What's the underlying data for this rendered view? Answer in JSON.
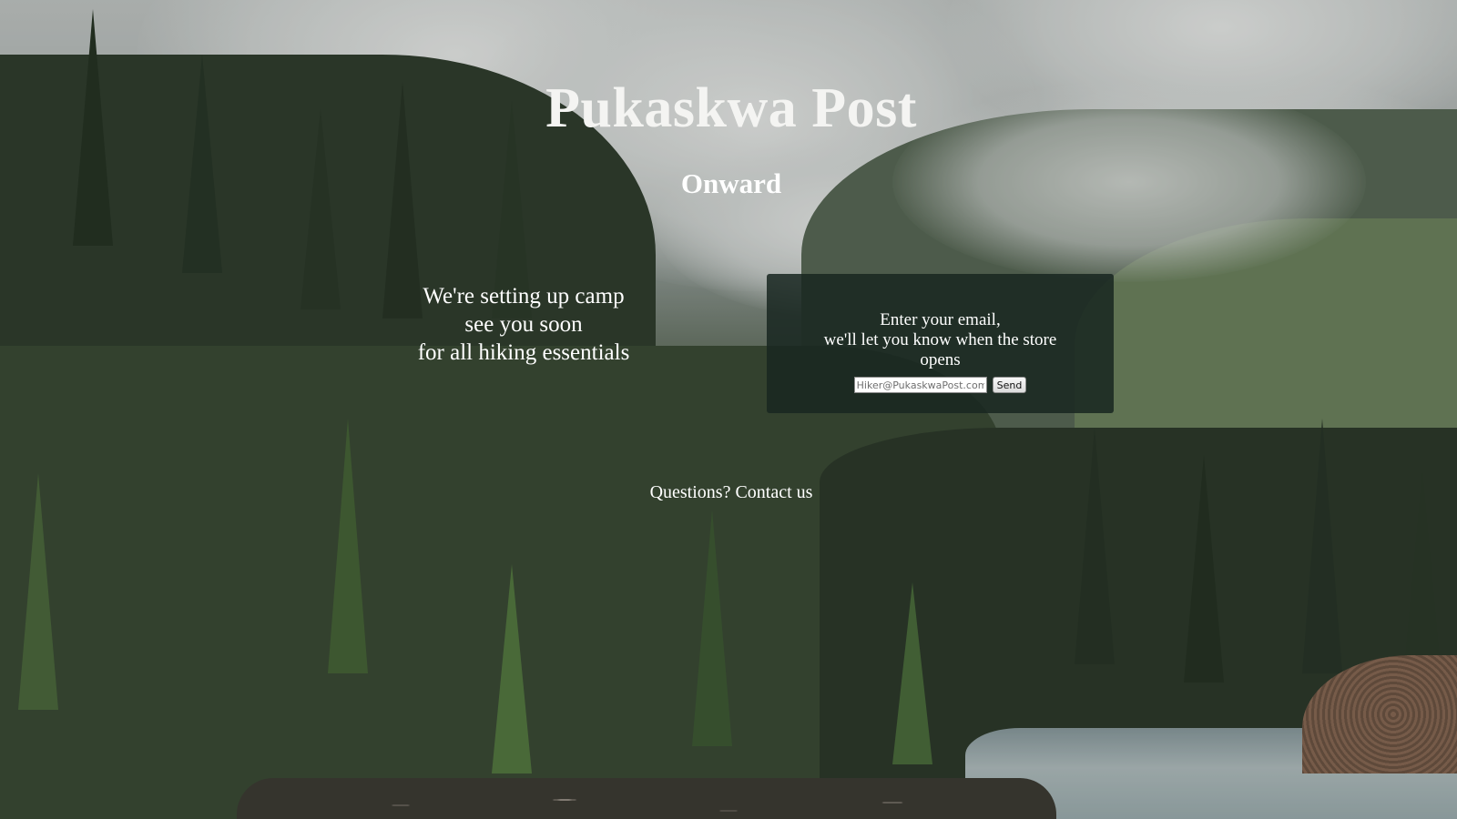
{
  "header": {
    "title": "Pukaskwa Post",
    "subtitle": "Onward"
  },
  "tagline": {
    "lines": [
      "We're setting up camp",
      "see you soon",
      "for all hiking essentials"
    ]
  },
  "signup": {
    "lines": [
      "Enter your email,",
      "we'll let you know when the store",
      "opens"
    ],
    "email_placeholder": "Hiker@PukaskwaPost.com",
    "send_label": "Send"
  },
  "footer": {
    "contact_label": "Questions? Contact us"
  },
  "background": {
    "image": "forest-mountain-river-photo",
    "colors": {
      "sky": "#c9cdcc",
      "forest": "#2d3a2c",
      "panel": "#192621"
    }
  }
}
